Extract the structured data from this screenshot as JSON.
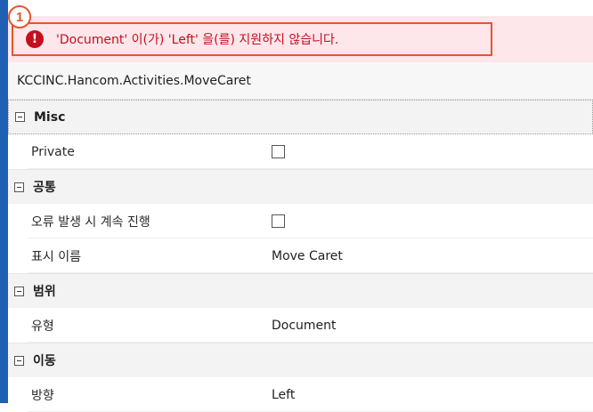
{
  "error": {
    "badge": "1",
    "icon": "error-circle-icon",
    "message": "'Document' 이(가) 'Left' 을(를) 지원하지 않습니다."
  },
  "classname": "KCCINC.Hancom.Activities.MoveCaret",
  "categories": [
    {
      "label": "Misc",
      "props": [
        {
          "label": "Private",
          "type": "checkbox",
          "checked": false
        }
      ]
    },
    {
      "label": "공통",
      "props": [
        {
          "label": "오류 발생 시 계속 진행",
          "type": "checkbox",
          "checked": false
        },
        {
          "label": "표시 이름",
          "type": "text",
          "value": "Move Caret"
        }
      ]
    },
    {
      "label": "범위",
      "props": [
        {
          "label": "유형",
          "type": "text",
          "value": "Document"
        }
      ]
    },
    {
      "label": "이동",
      "props": [
        {
          "label": "방향",
          "type": "text",
          "value": "Left"
        }
      ]
    }
  ],
  "colors": {
    "error_text": "#c50f1f",
    "highlight": "#e8542c",
    "accent": "#1f5fb4"
  }
}
